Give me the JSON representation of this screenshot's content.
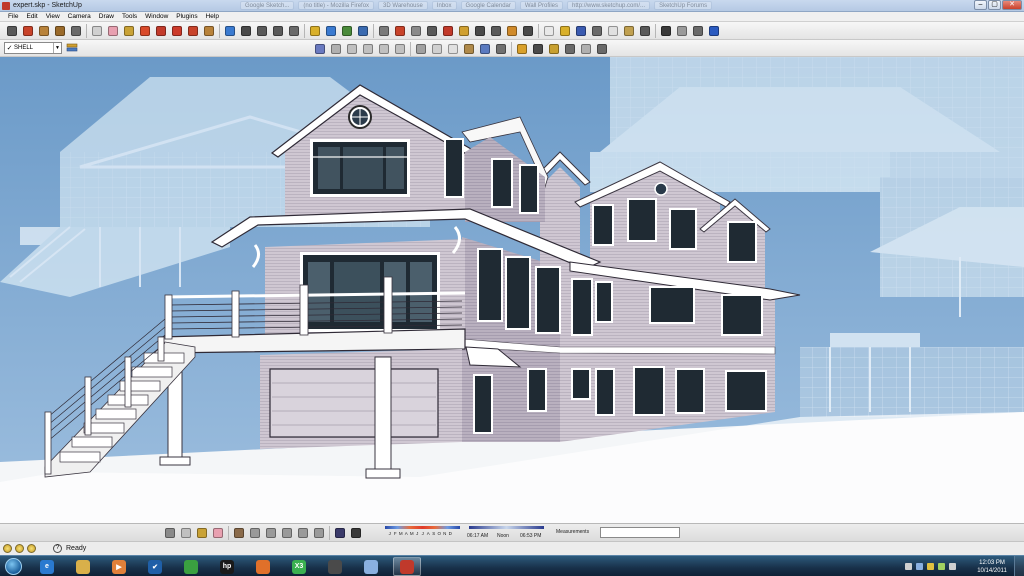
{
  "window": {
    "title": "expert.skp - SketchUp",
    "background_tabs": [
      "Google Sketch...",
      "(no title) - Mozilla Firefox",
      "3D Warehouse",
      "Inbox",
      "Google Calendar",
      "Wall Profiles",
      "http://www.sketchup.com/...",
      "SketchUp Forums"
    ],
    "minimize": "–",
    "maximize": "▢",
    "close": "✕"
  },
  "menu": [
    "File",
    "Edit",
    "View",
    "Camera",
    "Draw",
    "Tools",
    "Window",
    "Plugins",
    "Help"
  ],
  "toolbar_row1": [
    {
      "icon": "select-arrow-icon",
      "color": "#5a5a5a"
    },
    {
      "icon": "line-pencil-icon",
      "color": "#c8432a"
    },
    {
      "icon": "rectangle-icon",
      "color": "#b8823a"
    },
    {
      "icon": "circle-icon",
      "color": "#9a6a2a"
    },
    {
      "icon": "arc-icon",
      "color": "#6a6a6a"
    },
    {
      "icon": "make-component-icon",
      "color": "#d0d0d0"
    },
    {
      "icon": "eraser-icon",
      "color": "#e8a0b0"
    },
    {
      "icon": "paint-bucket-icon",
      "color": "#c9a236"
    },
    {
      "icon": "push-pull-icon",
      "color": "#d94a2a"
    },
    {
      "icon": "move-icon",
      "color": "#c23a2a"
    },
    {
      "icon": "rotate-icon",
      "color": "#cc3a2a"
    },
    {
      "icon": "follow-me-icon",
      "color": "#c8432a"
    },
    {
      "icon": "offset-icon",
      "color": "#b8823a"
    },
    {
      "icon": "orbit-icon",
      "color": "#3a7ad0"
    },
    {
      "icon": "pan-icon",
      "color": "#4a4a4a"
    },
    {
      "icon": "zoom-icon",
      "color": "#5a5a5a"
    },
    {
      "icon": "zoom-extents-icon",
      "color": "#5a5a5a"
    },
    {
      "icon": "previous-view-icon",
      "color": "#6a6a6a"
    },
    {
      "icon": "get-models-icon",
      "color": "#d9b02a"
    },
    {
      "icon": "share-model-icon",
      "color": "#3a7ad0"
    },
    {
      "icon": "components-icon",
      "color": "#4a8a3a"
    },
    {
      "icon": "google-earth-icon",
      "color": "#3a6ab0"
    },
    {
      "icon": "tape-measure-icon",
      "color": "#7a7a7a"
    },
    {
      "icon": "dimension-icon",
      "color": "#c8432a"
    },
    {
      "icon": "protractor-icon",
      "color": "#8a8a8a"
    },
    {
      "icon": "text-icon",
      "color": "#5a5a5a"
    },
    {
      "icon": "axes-icon",
      "color": "#c23a2a"
    },
    {
      "icon": "3d-text-icon",
      "color": "#d0a030"
    },
    {
      "icon": "walk-icon",
      "color": "#4a4a4a"
    },
    {
      "icon": "position-camera-icon",
      "color": "#5a5a5a"
    },
    {
      "icon": "section-plane-icon",
      "color": "#d08a2a"
    },
    {
      "icon": "look-around-icon",
      "color": "#4a4a4a"
    },
    {
      "icon": "new-file-icon",
      "color": "#e8e8e8"
    },
    {
      "icon": "open-folder-icon",
      "color": "#d9b02a"
    },
    {
      "icon": "save-icon",
      "color": "#3a5ab0"
    },
    {
      "icon": "cut-icon",
      "color": "#6a6a6a"
    },
    {
      "icon": "copy-icon",
      "color": "#e0e0e0"
    },
    {
      "icon": "paste-icon",
      "color": "#c0a050"
    },
    {
      "icon": "delete-icon",
      "color": "#5a5a5a"
    },
    {
      "icon": "undo-icon",
      "color": "#3a3a3a"
    },
    {
      "icon": "redo-icon",
      "color": "#9a9a9a"
    },
    {
      "icon": "print-icon",
      "color": "#6a6a6a"
    },
    {
      "icon": "model-info-icon",
      "color": "#2a5ac0"
    }
  ],
  "layer": {
    "current": "SHELL",
    "checkmark": "✓",
    "dropdown_arrow": "▼"
  },
  "toolbar_row2": [
    {
      "icon": "iso-view-icon",
      "color": "#6a7ac0"
    },
    {
      "icon": "top-view-icon",
      "color": "#b0b0b0"
    },
    {
      "icon": "front-view-icon",
      "color": "#c0c0c0"
    },
    {
      "icon": "right-view-icon",
      "color": "#c0c0c0"
    },
    {
      "icon": "back-view-icon",
      "color": "#c0c0c0"
    },
    {
      "icon": "left-view-icon",
      "color": "#c0c0c0"
    },
    {
      "icon": "xray-icon",
      "color": "#a0a0a0"
    },
    {
      "icon": "wireframe-icon",
      "color": "#d0d0d0"
    },
    {
      "icon": "hidden-line-icon",
      "color": "#e0e0e0"
    },
    {
      "icon": "shaded-icon",
      "color": "#b08a4a"
    },
    {
      "icon": "shaded-texture-icon",
      "color": "#5a7ac0"
    },
    {
      "icon": "monochrome-icon",
      "color": "#707070"
    },
    {
      "icon": "solid-tools-icon",
      "color": "#d9a02a"
    },
    {
      "icon": "sandbox-icon",
      "color": "#4a4a4a"
    },
    {
      "icon": "soften-icon",
      "color": "#c8a030"
    },
    {
      "icon": "match-photo-icon",
      "color": "#6a6a6a"
    },
    {
      "icon": "intersect-icon",
      "color": "#b0b0b0"
    },
    {
      "icon": "outer-shell-icon",
      "color": "#6a6a6a"
    }
  ],
  "bottom_toolbar": [
    {
      "icon": "select-small-icon",
      "color": "#8a8a8a"
    },
    {
      "icon": "components-small-icon",
      "color": "#c0c0c0"
    },
    {
      "icon": "paint-small-icon",
      "color": "#c9a236"
    },
    {
      "icon": "eraser-small-icon",
      "color": "#e8a0b0"
    },
    {
      "icon": "layer-tool-a-icon",
      "color": "#8a6a4a"
    },
    {
      "icon": "layer-tool-b-icon",
      "color": "#9a9a9a"
    },
    {
      "icon": "layer-tool-c-icon",
      "color": "#9a9a9a"
    },
    {
      "icon": "layer-tool-d-icon",
      "color": "#9a9a9a"
    },
    {
      "icon": "layer-tool-e-icon",
      "color": "#9a9a9a"
    },
    {
      "icon": "layer-tool-f-icon",
      "color": "#9a9a9a"
    },
    {
      "icon": "shadow-toggle-icon",
      "color": "#3a3a6a"
    },
    {
      "icon": "fog-toggle-icon",
      "color": "#3a3a3a"
    }
  ],
  "shadows": {
    "months": [
      "J",
      "F",
      "M",
      "A",
      "M",
      "J",
      "J",
      "A",
      "S",
      "O",
      "N",
      "D"
    ],
    "time_start": "06:17 AM",
    "time_noon": "Noon",
    "time_end": "06:53 PM"
  },
  "measurements_label": "Measurements",
  "status": {
    "text": "Ready",
    "help": "?"
  },
  "taskbar": {
    "apps": [
      {
        "name": "internet-explorer",
        "color": "#2a7ad0",
        "glyph": "e"
      },
      {
        "name": "file-explorer",
        "color": "#d9b04a",
        "glyph": ""
      },
      {
        "name": "media-player",
        "color": "#e0803a",
        "glyph": "▶"
      },
      {
        "name": "checkmark-app",
        "color": "#1f5fa8",
        "glyph": "✔"
      },
      {
        "name": "image-app",
        "color": "#3aa040",
        "glyph": ""
      },
      {
        "name": "hp-app",
        "color": "#1a1a1a",
        "glyph": "hp"
      },
      {
        "name": "firefox",
        "color": "#e0702a",
        "glyph": ""
      },
      {
        "name": "x3-app",
        "color": "#3ab050",
        "glyph": "X3"
      },
      {
        "name": "game-app",
        "color": "#4a4a4a",
        "glyph": ""
      },
      {
        "name": "document-app",
        "color": "#8ab0e0",
        "glyph": ""
      },
      {
        "name": "sketchup-app",
        "color": "#c0392b",
        "glyph": ""
      }
    ],
    "active_app_index": 10,
    "clock_time": "12:03 PM",
    "clock_date": "10/14/2011",
    "tray_colors": [
      "#d0d0d0",
      "#8ab0e0",
      "#e0c040",
      "#a0d060",
      "#d0d0d0"
    ]
  }
}
